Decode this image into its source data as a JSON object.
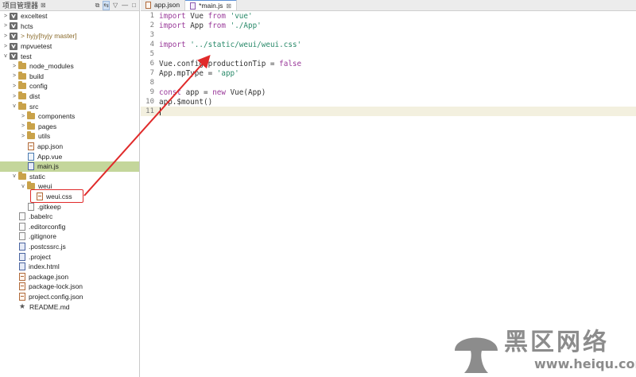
{
  "explorer": {
    "title": "项目管理器",
    "close_glyph": "⊠",
    "tools": [
      "⧉",
      "⇆",
      "▽",
      "—",
      "□"
    ],
    "items": [
      {
        "label": "exceltest",
        "icon": "project-icon",
        "indent": 0,
        "twisty": ">"
      },
      {
        "label": "hcts",
        "icon": "project-icon",
        "indent": 0,
        "twisty": ">"
      },
      {
        "label": "> hyjy",
        "git": " [hyjy master]",
        "icon": "project-icon",
        "indent": 0,
        "twisty": ">"
      },
      {
        "label": "mpvuetest",
        "icon": "project-icon",
        "indent": 0,
        "twisty": ">"
      },
      {
        "label": "test",
        "icon": "project-icon",
        "indent": 0,
        "twisty": "v"
      },
      {
        "label": "node_modules",
        "icon": "folder-icon",
        "indent": 1,
        "twisty": ">"
      },
      {
        "label": "build",
        "icon": "folder-icon",
        "indent": 1,
        "twisty": ">"
      },
      {
        "label": "config",
        "icon": "folder-icon",
        "indent": 1,
        "twisty": ">"
      },
      {
        "label": "dist",
        "icon": "folder-icon",
        "indent": 1,
        "twisty": ">"
      },
      {
        "label": "src",
        "icon": "folder-icon",
        "indent": 1,
        "twisty": "v"
      },
      {
        "label": "components",
        "icon": "folder-icon",
        "indent": 2,
        "twisty": ">"
      },
      {
        "label": "pages",
        "icon": "folder-icon",
        "indent": 2,
        "twisty": ">"
      },
      {
        "label": "utils",
        "icon": "folder-icon",
        "indent": 2,
        "twisty": ">"
      },
      {
        "label": "app.json",
        "icon": "code-file-icon",
        "indent": 2,
        "twisty": ""
      },
      {
        "label": "App.vue",
        "icon": "vue-file-icon",
        "indent": 2,
        "twisty": ""
      },
      {
        "label": "main.js",
        "icon": "image-file-icon",
        "indent": 2,
        "twisty": "",
        "selected": true
      },
      {
        "label": "static",
        "icon": "folder-icon",
        "indent": 1,
        "twisty": "v"
      },
      {
        "label": "weui",
        "icon": "folder-icon",
        "indent": 2,
        "twisty": "v"
      },
      {
        "label": "weui.css",
        "icon": "code-file-icon",
        "indent": 3,
        "twisty": ""
      },
      {
        "label": ".gitkeep",
        "icon": "file-icon",
        "indent": 2,
        "twisty": ""
      },
      {
        "label": ".babelrc",
        "icon": "file-icon",
        "indent": 1,
        "twisty": ""
      },
      {
        "label": ".editorconfig",
        "icon": "file-icon",
        "indent": 1,
        "twisty": ""
      },
      {
        "label": ".gitignore",
        "icon": "file-icon",
        "indent": 1,
        "twisty": ""
      },
      {
        "label": ".postcssrc.js",
        "icon": "image-file-icon",
        "indent": 1,
        "twisty": ""
      },
      {
        "label": ".project",
        "icon": "image-file-icon",
        "indent": 1,
        "twisty": ""
      },
      {
        "label": "index.html",
        "icon": "image-file-icon",
        "indent": 1,
        "twisty": ""
      },
      {
        "label": "package.json",
        "icon": "code-file-icon",
        "indent": 1,
        "twisty": ""
      },
      {
        "label": "package-lock.json",
        "icon": "code-file-icon",
        "indent": 1,
        "twisty": ""
      },
      {
        "label": "project.config.json",
        "icon": "code-file-icon",
        "indent": 1,
        "twisty": ""
      },
      {
        "label": "README.md",
        "icon": "star-icon",
        "indent": 1,
        "twisty": ""
      }
    ]
  },
  "editor": {
    "tabs": [
      {
        "label": "app.json",
        "icon": "code-file-icon",
        "active": false
      },
      {
        "label": "*main.js",
        "icon": "image-file-icon",
        "active": true,
        "close": "⊠"
      }
    ],
    "lines": [
      {
        "n": "1",
        "tokens": [
          [
            "kw",
            "import"
          ],
          [
            "t",
            " Vue "
          ],
          [
            "kw",
            "from"
          ],
          [
            "t",
            " "
          ],
          [
            "str",
            "'vue'"
          ]
        ]
      },
      {
        "n": "2",
        "tokens": [
          [
            "kw",
            "import"
          ],
          [
            "t",
            " App "
          ],
          [
            "kw",
            "from"
          ],
          [
            "t",
            " "
          ],
          [
            "str",
            "'./App'"
          ]
        ]
      },
      {
        "n": "3",
        "tokens": []
      },
      {
        "n": "4",
        "tokens": [
          [
            "kw",
            "import"
          ],
          [
            "t",
            " "
          ],
          [
            "str",
            "'../static/weui/weui.css'"
          ]
        ]
      },
      {
        "n": "5",
        "tokens": []
      },
      {
        "n": "6",
        "tokens": [
          [
            "t",
            "Vue.config.productionTip = "
          ],
          [
            "bool",
            "false"
          ]
        ]
      },
      {
        "n": "7",
        "tokens": [
          [
            "t",
            "App.mpType = "
          ],
          [
            "str",
            "'app'"
          ]
        ]
      },
      {
        "n": "8",
        "tokens": []
      },
      {
        "n": "9",
        "tokens": [
          [
            "kw",
            "const"
          ],
          [
            "t",
            " app = "
          ],
          [
            "kw",
            "new"
          ],
          [
            "t",
            " Vue(App)"
          ]
        ]
      },
      {
        "n": "10",
        "tokens": [
          [
            "t",
            "app.$mount()"
          ]
        ]
      },
      {
        "n": "11",
        "tokens": [],
        "current": true
      }
    ]
  },
  "watermark": {
    "text": "黑区网络",
    "url": "www.heiqu.com"
  },
  "colors": {
    "selection": "#c4d69b",
    "annotation": "#e02a2a",
    "keyword": "#9a3a9a",
    "string": "#2a8a6a"
  }
}
